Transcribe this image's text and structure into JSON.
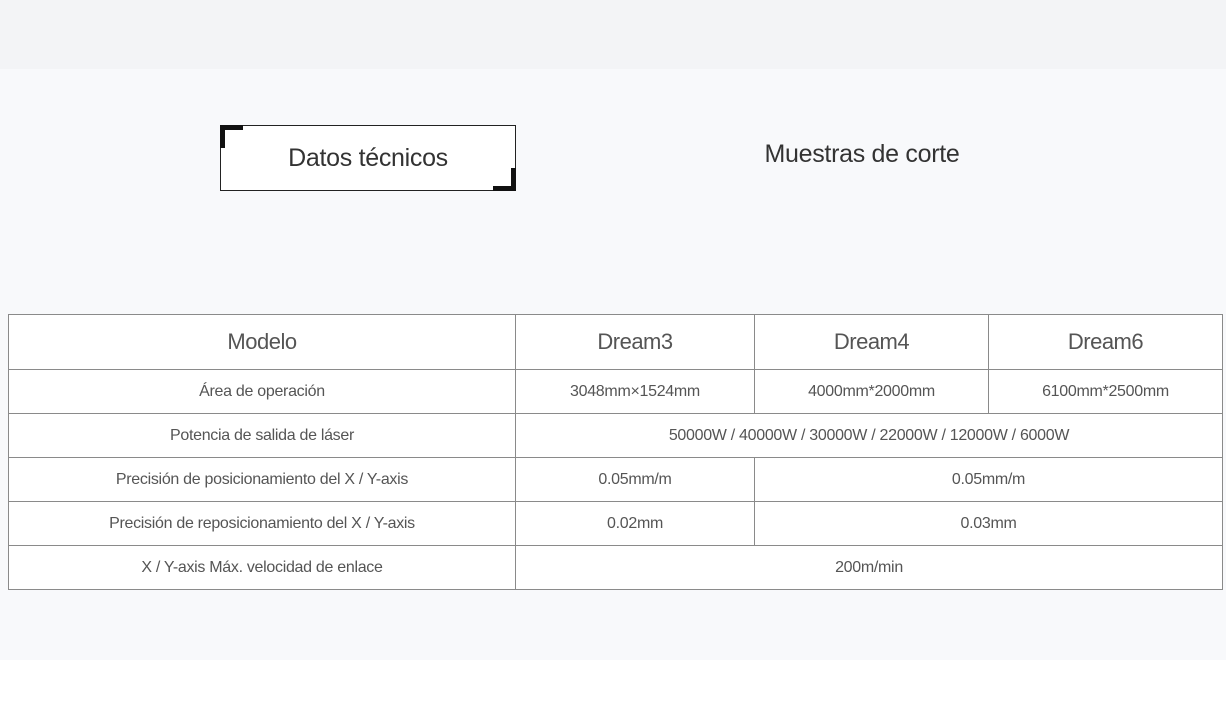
{
  "tabs": [
    {
      "label": "Datos técnicos",
      "active": true
    },
    {
      "label": "Muestras de corte",
      "active": false
    }
  ],
  "table": {
    "headers": [
      "Modelo",
      "Dream3",
      "Dream4",
      "Dream6"
    ],
    "rows": {
      "area": {
        "label": "Área de operación",
        "dream3": "3048mm×1524mm",
        "dream4": "4000mm*2000mm",
        "dream6": "6100mm*2500mm"
      },
      "power": {
        "label": "Potencia de salida de láser",
        "all": "50000W / 40000W / 30000W / 22000W / 12000W / 6000W"
      },
      "positioning": {
        "label": "Precisión de posicionamiento del X / Y-axis",
        "dream3": "0.05mm/m",
        "dream4_6": "0.05mm/m"
      },
      "repositioning": {
        "label": "Precisión de reposicionamiento del X / Y-axis",
        "dream3": "0.02mm",
        "dream4_6": "0.03mm"
      },
      "speed": {
        "label": "X / Y-axis Máx. velocidad de enlace",
        "all": "200m/min"
      }
    }
  }
}
